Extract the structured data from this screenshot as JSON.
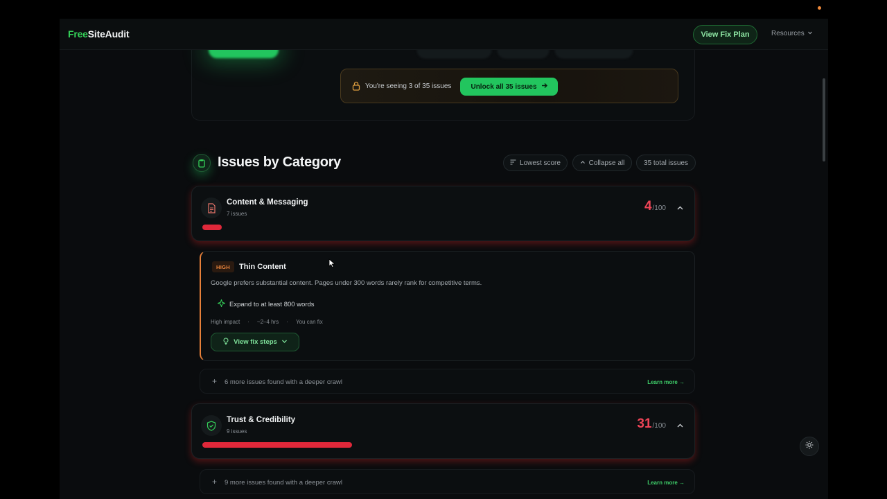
{
  "nav": {
    "logo_part1": "Free",
    "logo_part2": "SiteAudit",
    "fix_plan_label": "View Fix Plan",
    "resources_label": "Resources"
  },
  "unlock": {
    "seeing_text": "You're seeing 3 of 35 issues",
    "button_label": "Unlock all 35 issues"
  },
  "section": {
    "title": "Issues by Category",
    "sort_label": "Lowest score",
    "collapse_label": "Collapse all",
    "total_label": "35 total issues"
  },
  "categories": [
    {
      "name": "Content & Messaging",
      "count": "7 issues",
      "score": "4",
      "score_den": "/100",
      "bar_fraction": 0.04
    },
    {
      "name": "Trust & Credibility",
      "count": "9 issues",
      "score": "31",
      "score_den": "/100",
      "bar_fraction": 0.31
    }
  ],
  "issue": {
    "severity": "HIGH",
    "title": "Thin Content",
    "description": "Google prefers substantial content. Pages under 300 words rarely rank for competitive terms.",
    "action": "Expand to at least 800 words",
    "impact": "High impact",
    "time": "~2–4 hrs",
    "who": "You can fix",
    "fix_label": "View fix steps",
    "dot": "·"
  },
  "more_rows": [
    {
      "text": "6 more issues found with a deeper crawl",
      "learn": "Learn more →"
    },
    {
      "text": "9 more issues found with a deeper crawl",
      "learn": "Learn more →"
    }
  ],
  "colors": {
    "accent": "#22c55e",
    "danger": "#e0283a",
    "warning": "#f0883e"
  }
}
